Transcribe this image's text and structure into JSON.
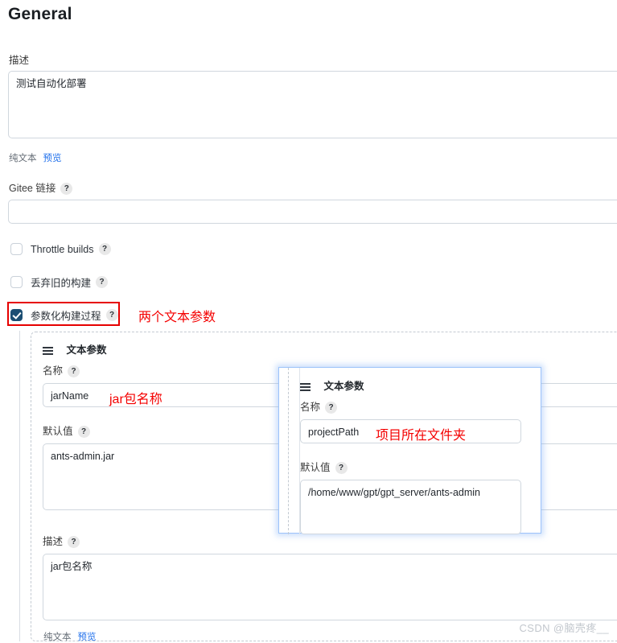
{
  "page": {
    "title": "General"
  },
  "description_field": {
    "label": "描述",
    "value": "测试自动化部署",
    "plain_text_label": "纯文本",
    "preview_label": "预览"
  },
  "gitee_field": {
    "label": "Gitee 链接",
    "help": "?",
    "value": ""
  },
  "checkboxes": [
    {
      "label": "Throttle builds",
      "help": "?",
      "checked": false
    },
    {
      "label": "丢弃旧的构建",
      "help": "?",
      "checked": false
    },
    {
      "label": "参数化构建过程",
      "help": "?",
      "checked": true
    }
  ],
  "annotations": {
    "param_count_note": "两个文本参数",
    "jar_name_note": "jar包名称",
    "project_path_note": "项目所在文件夹",
    "highlight_color": "#e60000",
    "note_color": "#f40000"
  },
  "param_card_1": {
    "drag_icon": "hamburger-drag-icon",
    "title": "文本参数",
    "name": {
      "label": "名称",
      "help": "?",
      "value": "jarName"
    },
    "default": {
      "label": "默认值",
      "help": "?",
      "value": "ants-admin.jar"
    },
    "description": {
      "label": "描述",
      "help": "?",
      "value": "jar包名称"
    },
    "plain_text_label": "纯文本",
    "preview_label": "预览"
  },
  "param_card_2": {
    "drag_icon": "hamburger-drag-icon",
    "title": "文本参数",
    "name": {
      "label": "名称",
      "help": "?",
      "value": "projectPath"
    },
    "default": {
      "label": "默认值",
      "help": "?",
      "value": "/home/www/gpt/gpt_server/ants-admin"
    }
  },
  "watermark": {
    "text": "CSDN @脑壳疼__"
  }
}
